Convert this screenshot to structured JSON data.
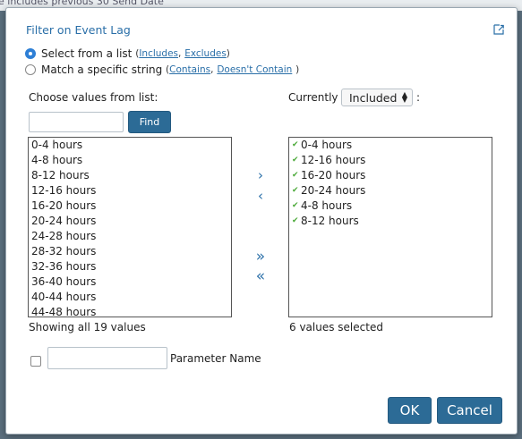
{
  "background": {
    "partial_text": "e includes previous 30 Send Date"
  },
  "dialog": {
    "title": "Filter on Event Lag",
    "popout_icon": "popout-icon"
  },
  "mode": {
    "list_option": {
      "label": "Select from a list",
      "open_paren": "(",
      "includes": "Includes",
      "comma": ",",
      "excludes": "Excludes",
      "close_paren": ")",
      "selected": true
    },
    "string_option": {
      "label": "Match a specific string",
      "open_paren": "(",
      "contains": "Contains",
      "comma": ",",
      "doesnt_contain": "Doesn't Contain",
      "close_paren": ")",
      "selected": false
    }
  },
  "left": {
    "heading": "Choose values from list:",
    "search_value": "",
    "find_label": "Find",
    "items": [
      "0-4 hours",
      "4-8 hours",
      "8-12 hours",
      "12-16 hours",
      "16-20 hours",
      "20-24 hours",
      "24-28 hours",
      "28-32 hours",
      "32-36 hours",
      "36-40 hours",
      "40-44 hours",
      "44-48 hours"
    ],
    "footer": "Showing all 19 values"
  },
  "right": {
    "currently_label": "Currently",
    "select_value": "Included",
    "colon": ":",
    "items": [
      "0-4 hours",
      "12-16 hours",
      "16-20 hours",
      "20-24 hours",
      "4-8 hours",
      "8-12 hours"
    ],
    "footer": "6 values selected"
  },
  "move": {
    "add": "›",
    "remove": "‹",
    "add_all": "»",
    "remove_all": "«"
  },
  "parameter": {
    "label": "Parameter Name",
    "value": "",
    "checked": false
  },
  "buttons": {
    "ok": "OK",
    "cancel": "Cancel"
  },
  "colors": {
    "accent": "#2c6b96",
    "link": "#2a6fa8",
    "check": "#4caa3a"
  }
}
